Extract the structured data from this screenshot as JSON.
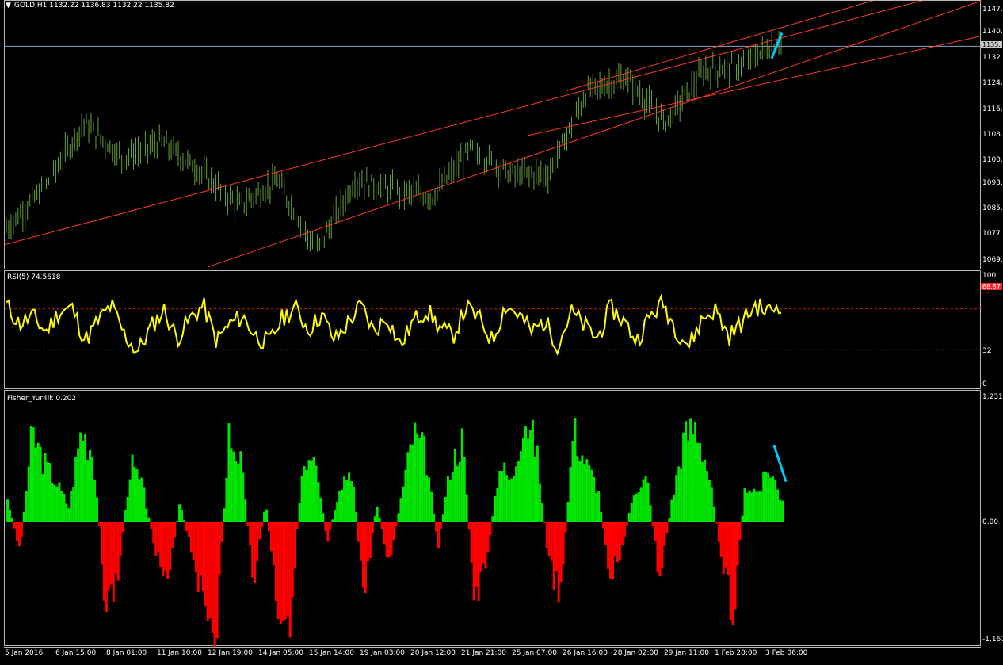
{
  "chart_data": [
    {
      "type": "line",
      "title": "GOLD,H1  1132.22 1136.83 1132.22 1135.82",
      "symbol": "GOLD",
      "timeframe": "H1",
      "ohlc_readout": {
        "open": 1132.22,
        "high": 1136.83,
        "low": 1132.22,
        "close": 1135.82
      },
      "ylim": [
        1066,
        1150
      ],
      "ytick_labels": [
        "1147.",
        "1140.",
        "1132.",
        "1124.",
        "1116.",
        "1108.",
        "1100.",
        "1093.",
        "1085.",
        "1077.",
        "1069."
      ],
      "ytick_values": [
        1147,
        1140,
        1132,
        1124,
        1116,
        1108,
        1100,
        1093,
        1085,
        1077,
        1069
      ],
      "current_price_label": "1135.",
      "current_price": 1135.82,
      "x": [
        0,
        5,
        10,
        15,
        20,
        25,
        30,
        35,
        40,
        45,
        50,
        55,
        60,
        65,
        70,
        75,
        80,
        85,
        90,
        95,
        100
      ],
      "series": [
        {
          "values": [
            1079,
            1092,
            1112,
            1101,
            1106,
            1097,
            1086,
            1094,
            1072,
            1094,
            1091,
            1089,
            1104,
            1096,
            1096,
            1122,
            1126,
            1112,
            1128,
            1130,
            1138
          ]
        }
      ],
      "trendlines": [
        {
          "from": [
            0,
            1074
          ],
          "to": [
            100,
            1155
          ]
        },
        {
          "from": [
            26,
            1067
          ],
          "to": [
            100,
            1150
          ]
        },
        {
          "from": [
            67,
            1108
          ],
          "to": [
            100,
            1139
          ]
        },
        {
          "from": [
            72,
            1122
          ],
          "to": [
            100,
            1160
          ]
        }
      ],
      "annotation_color": "#00c8ff",
      "candle_color": "#66a32e",
      "trendline_color": "#ff3b1f"
    },
    {
      "type": "line",
      "title": "RSI(5) 74.5618",
      "ylim": [
        0,
        100
      ],
      "ytick_labels": [
        "100",
        "32",
        "0"
      ],
      "levels": [
        32,
        68.87
      ],
      "level_label": "68.87",
      "series": [
        {
          "values": [
            72,
            55,
            62,
            48,
            66,
            70,
            40,
            58,
            72,
            45,
            30,
            52,
            68,
            42,
            60,
            72,
            40,
            55,
            62,
            44,
            38,
            60,
            70,
            50,
            64,
            40,
            56,
            72,
            48,
            62,
            35,
            58,
            68,
            52,
            44,
            70,
            60,
            40,
            72,
            64,
            48,
            58,
            36,
            66,
            54,
            42,
            70,
            58,
            40,
            62,
            74,
            50,
            36,
            60,
            68,
            44,
            56,
            72,
            66,
            74
          ]
        }
      ],
      "color": "#ffff00"
    },
    {
      "type": "bar",
      "title": "Fisher_Yur4ik 0.202",
      "ylim": [
        -1.167,
        1.231
      ],
      "ytick_labels": [
        "1.231",
        "0.00",
        "-1.167"
      ],
      "series": [
        {
          "values": [
            0.25,
            -0.3,
            0.9,
            0.6,
            0.4,
            0.15,
            0.95,
            0.7,
            -0.9,
            -0.55,
            0.6,
            0.35,
            -0.25,
            -0.7,
            0.2,
            -0.3,
            -0.85,
            -1.1,
            0.9,
            0.6,
            -0.6,
            0.2,
            -0.9,
            -0.95,
            0.6,
            0.8,
            -0.25,
            0.4,
            0.55,
            -0.8,
            0.2,
            -0.45,
            0.25,
            0.9,
            0.7,
            -0.25,
            0.55,
            0.85,
            -0.9,
            -0.35,
            0.6,
            0.4,
            1.1,
            0.75,
            -0.4,
            -0.8,
            0.95,
            0.6,
            0.35,
            -0.55,
            -0.25,
            0.35,
            0.45,
            -0.6,
            0.2,
            0.85,
            1.0,
            0.5,
            -0.3,
            -0.95,
            0.4,
            0.3,
            0.55,
            0.202
          ]
        }
      ],
      "positive_color": "#00e600",
      "negative_color": "#ff0000"
    }
  ],
  "x_axis": {
    "labels": [
      "5 Jan 2016",
      "6 Jan 15:00",
      "8 Jan 01:00",
      "11 Jan 10:00",
      "12 Jan 19:00",
      "14 Jan 05:00",
      "15 Jan 14:00",
      "19 Jan 03:00",
      "20 Jan 12:00",
      "21 Jan 21:00",
      "25 Jan 07:00",
      "26 Jan 16:00",
      "28 Jan 02:00",
      "29 Jan 11:00",
      "1 Feb 20:00",
      "3 Feb 06:00"
    ]
  }
}
